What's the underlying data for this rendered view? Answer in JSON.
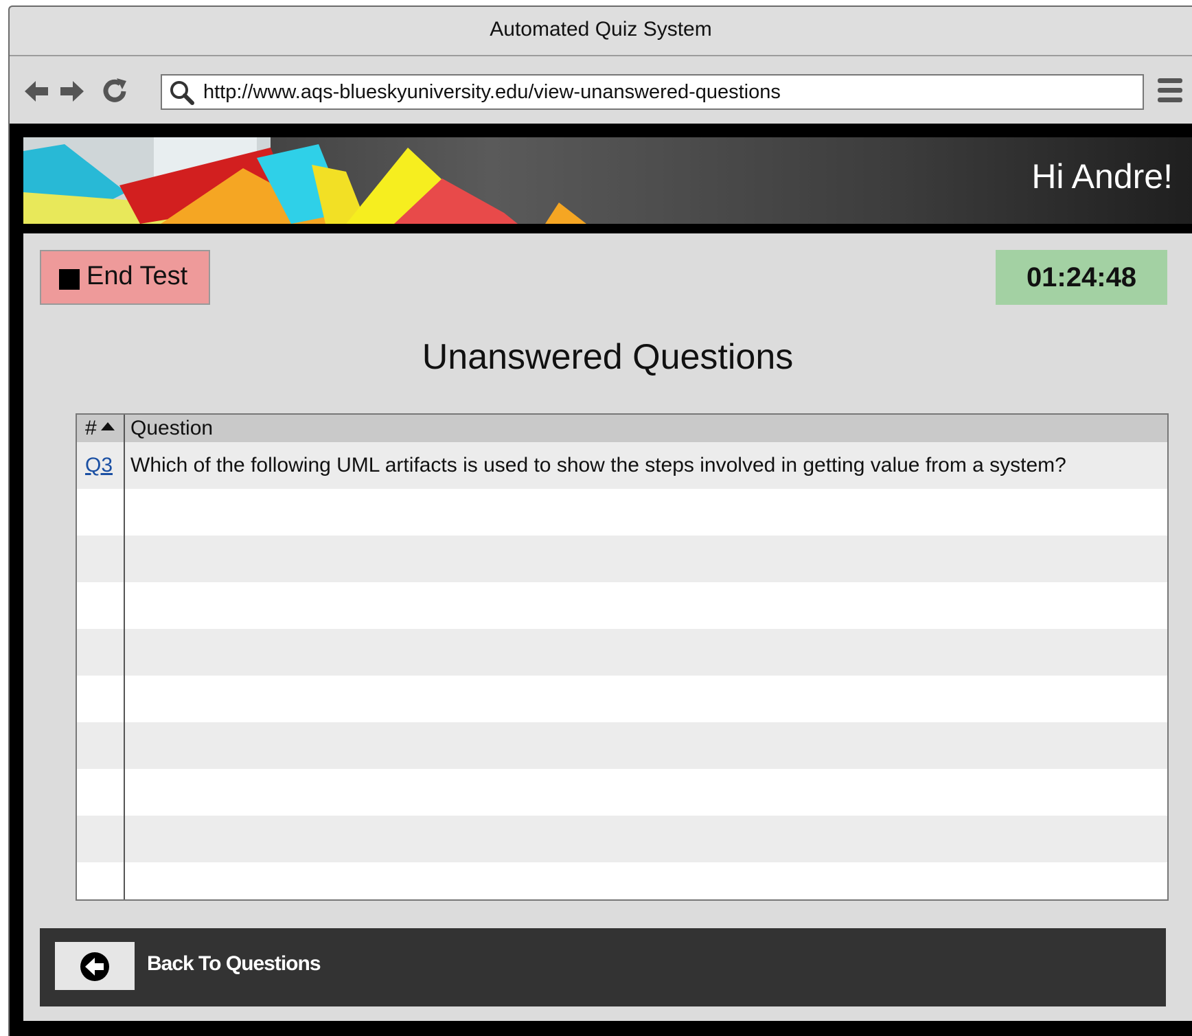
{
  "window": {
    "title": "Automated Quiz System"
  },
  "browser": {
    "url": "http://www.aqs-blueskyuniversity.edu/view-unanswered-questions"
  },
  "header": {
    "greeting": "Hi Andre!"
  },
  "controls": {
    "end_test_label": "End Test",
    "timer": "01:24:48"
  },
  "page": {
    "title": "Unanswered Questions"
  },
  "table": {
    "columns": [
      "#",
      "Question"
    ],
    "rows": [
      {
        "id": "Q3",
        "question": "Which of the following UML artifacts is used to show the steps involved in getting value from a system?"
      }
    ]
  },
  "footer": {
    "back_label": "Back To Questions"
  },
  "colors": {
    "end_test_bg": "#ee9a9a",
    "timer_bg": "#a3d1a3",
    "link": "#1a4fa3",
    "footer_bg": "#333333"
  },
  "icons": [
    "back-arrow-icon",
    "forward-arrow-icon",
    "reload-icon",
    "search-icon",
    "hamburger-menu-icon",
    "stop-icon",
    "sort-asc-icon",
    "back-circle-icon"
  ]
}
